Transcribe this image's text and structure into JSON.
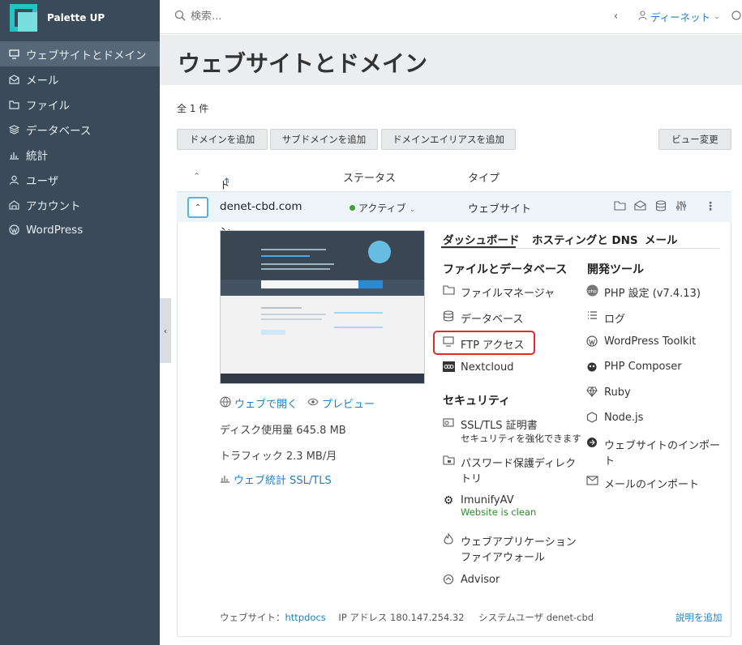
{
  "brand": {
    "name": "Palette UP"
  },
  "sidebar": {
    "items": [
      {
        "label": "ウェブサイトとドメイン",
        "icon": "monitor-icon",
        "active": true
      },
      {
        "label": "メール",
        "icon": "mail-icon"
      },
      {
        "label": "ファイル",
        "icon": "folder-icon"
      },
      {
        "label": "データベース",
        "icon": "database-icon"
      },
      {
        "label": "統計",
        "icon": "chart-icon"
      },
      {
        "label": "ユーザ",
        "icon": "user-icon"
      },
      {
        "label": "アカウント",
        "icon": "account-icon"
      },
      {
        "label": "WordPress",
        "icon": "wordpress-icon"
      }
    ]
  },
  "topbar": {
    "search_placeholder": "検索...",
    "user": "ディーネット"
  },
  "page": {
    "title": "ウェブサイトとドメイン",
    "total": "全 1 件"
  },
  "toolbar": {
    "add_domain": "ドメインを追加",
    "add_subdomain": "サブドメインを追加",
    "add_alias": "ドメインエイリアスを追加",
    "change_view": "ビュー変更"
  },
  "list": {
    "headers": {
      "name": "ドメイン名",
      "status": "ステータス",
      "type": "タイプ"
    },
    "row": {
      "domain": "denet-cbd.com",
      "status": "アクティブ",
      "type": "ウェブサイト"
    }
  },
  "details": {
    "open_web": "ウェブで開く",
    "preview": "プレビュー",
    "disk_usage": "ディスク使用量 645.8 MB",
    "traffic": "トラフィック 2.3 MB/月",
    "web_stats": "ウェブ統計 SSL/TLS"
  },
  "tabs": [
    "ダッシュボード",
    "ホスティングと DNS",
    "メール"
  ],
  "sections": {
    "files_db": {
      "title": "ファイルとデータベース",
      "items": [
        "ファイルマネージャ",
        "データベース",
        "FTP アクセス",
        "Nextcloud"
      ]
    },
    "security": {
      "title": "セキュリティ",
      "ssl": {
        "label": "SSL/TLS 証明書",
        "sub": "セキュリティを強化できます"
      },
      "password": "パスワード保護ディレクトリ",
      "imunify": {
        "label": "ImunifyAV",
        "sub": "Website is clean"
      },
      "waf": "ウェブアプリケーションファイアウォール",
      "advisor": "Advisor"
    },
    "dev": {
      "title": "開発ツール",
      "items": [
        "PHP 設定 (v7.4.13)",
        "ログ",
        "WordPress Toolkit",
        "PHP Composer",
        "Ruby",
        "Node.js",
        "ウェブサイトのインポート",
        "メールのインポート"
      ]
    }
  },
  "footer": {
    "website_label": "ウェブサイト：",
    "website_value": "httpdocs",
    "ip": "IP アドレス 180.147.254.32",
    "sysuser": "システムユーザ denet-cbd",
    "add_description": "説明を追加"
  }
}
